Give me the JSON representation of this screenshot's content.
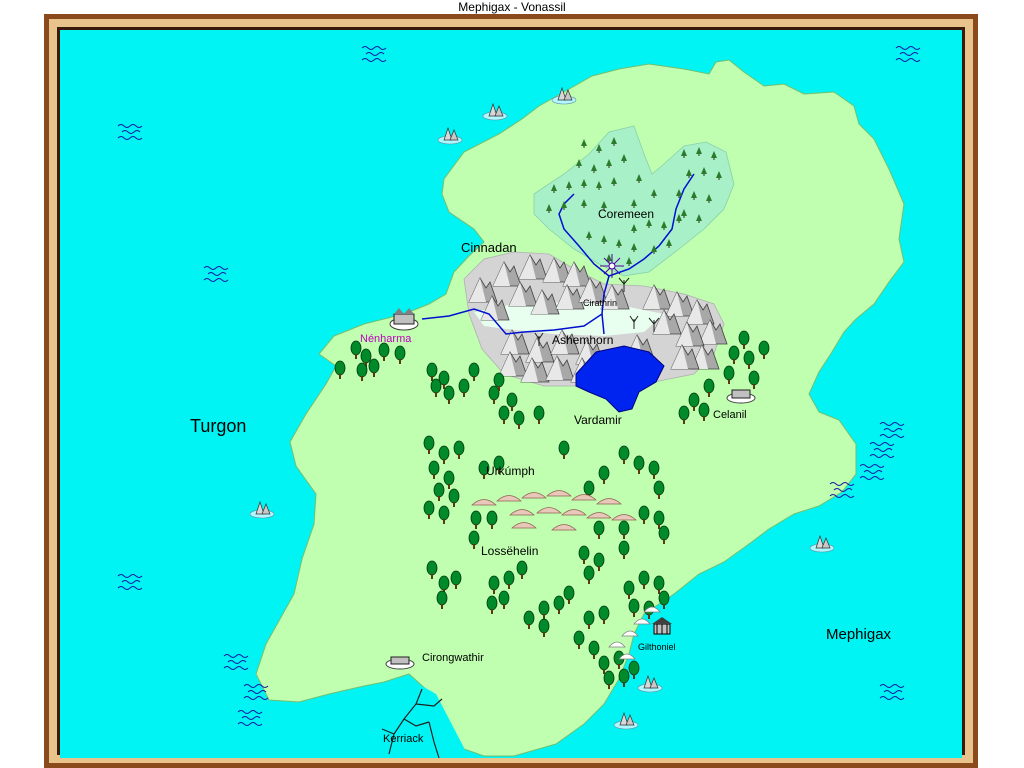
{
  "window": {
    "title": "Mephigax - Vonassil"
  },
  "colors": {
    "sea": "#00f4f4",
    "land": "#bfffaf",
    "frame_outer": "#8b4a1c",
    "frame_inner": "#e8c48c",
    "forest_dark": "#008a2a",
    "lake": "#0024f0",
    "river": "#0010d0",
    "label_special": "#c000c0"
  },
  "regions": {
    "west_sea": "Turgon",
    "east_sea": "Mephigax"
  },
  "places": {
    "cinnadan": "Cinnadan",
    "coremeen": "Coremeen",
    "cirathrin": "Cirathrin",
    "ashemhorn": "Ashemhorn",
    "nenharma": "Nénharma",
    "vardamir": "Vardamir",
    "celanil": "Celanil",
    "urkumph": "Urkúmph",
    "lossehelin": "Lossëhelin",
    "gilthoniel": "Gilthoniel",
    "cirongwathir": "Cirongwathir",
    "kerriack": "Kerriack"
  }
}
